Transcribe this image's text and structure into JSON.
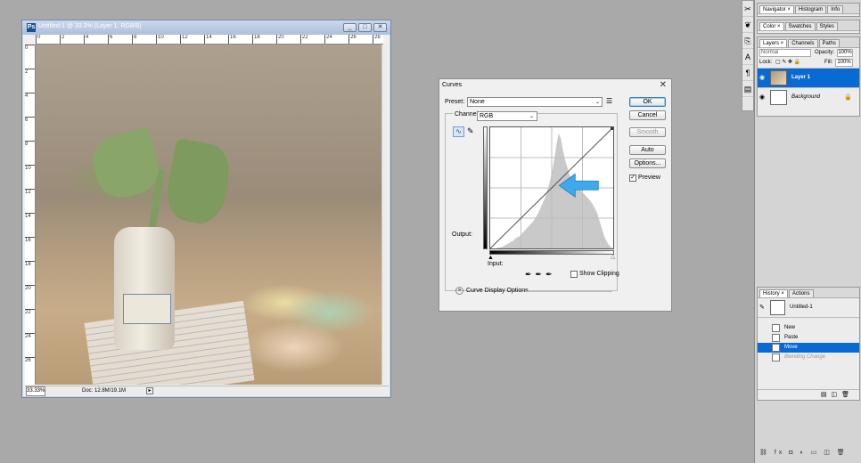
{
  "document": {
    "title": "Untitled-1 @ 33.3% (Layer 1, RGB/8)",
    "app_icon": "Ps",
    "ruler_ticks": [
      "0",
      "2",
      "4",
      "6",
      "8",
      "10",
      "12",
      "14",
      "16",
      "18",
      "20",
      "22",
      "24",
      "26",
      "28"
    ],
    "ruler_left_ticks": [
      "0",
      "2",
      "4",
      "6",
      "8",
      "10",
      "12",
      "14",
      "16",
      "18",
      "20",
      "22",
      "24",
      "26"
    ],
    "zoom": "33.33%",
    "doc_size": "Doc: 12.8M/19.1M"
  },
  "curves": {
    "title": "Curves",
    "preset_label": "Preset:",
    "preset_value": "None",
    "channel_label": "Channel:",
    "channel_value": "RGB",
    "output_label": "Output:",
    "input_label": "Input:",
    "show_clipping_label": "Show Clipping",
    "display_options_label": "Curve Display Options",
    "buttons": {
      "ok": "OK",
      "cancel": "Cancel",
      "smooth": "Smooth",
      "auto": "Auto",
      "options": "Options..."
    },
    "preview_label": "Preview",
    "preview_checked": true,
    "arrow_color": "#3ea9ec",
    "histogram": [
      0,
      0,
      0,
      0,
      1,
      1,
      2,
      3,
      4,
      5,
      6,
      8,
      9,
      10,
      12,
      14,
      16,
      18,
      20,
      22,
      25,
      28,
      32,
      36,
      40,
      46,
      52,
      60,
      70,
      82,
      92,
      88,
      78,
      70,
      64,
      58,
      54,
      52,
      50,
      48,
      46,
      44,
      42,
      40,
      38,
      35,
      32,
      28,
      22,
      16,
      10,
      6,
      3,
      1,
      0
    ]
  },
  "dock": {
    "nav_tabs": [
      "Navigator",
      "Histogram",
      "Info"
    ],
    "color_tabs": [
      "Color",
      "Swatches",
      "Styles"
    ],
    "layer_tabs": [
      "Layers",
      "Channels",
      "Paths"
    ],
    "blend_mode": "Normal",
    "opacity_label": "Opacity:",
    "opacity_value": "100%",
    "lock_label": "Lock:",
    "fill_label": "Fill:",
    "fill_value": "100%",
    "layers": [
      {
        "name": "Layer 1",
        "selected": true
      },
      {
        "name": "Background",
        "selected": false
      }
    ],
    "history_tabs": [
      "History",
      "Actions"
    ],
    "history_source": "Untitled-1",
    "history_states": [
      {
        "name": "New",
        "state": "normal"
      },
      {
        "name": "Paste",
        "state": "normal"
      },
      {
        "name": "Move",
        "state": "selected"
      },
      {
        "name": "Blending Change",
        "state": "undone"
      }
    ]
  }
}
